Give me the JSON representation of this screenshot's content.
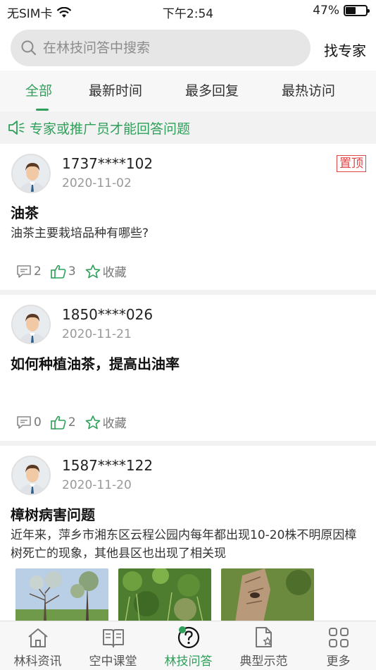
{
  "status_bar": {
    "carrier": "无SIM卡",
    "time": "下午2:54",
    "battery_percent": "47%",
    "battery_level": 0.47
  },
  "search": {
    "placeholder": "在林技问答中搜索",
    "expert_label": "找专家"
  },
  "tabs": [
    {
      "label": "全部",
      "active": true
    },
    {
      "label": "最新时间",
      "active": false
    },
    {
      "label": "最多回复",
      "active": false
    },
    {
      "label": "最热访问",
      "active": false
    }
  ],
  "notice": "专家或推广员才能回答问题",
  "questions": [
    {
      "user": "1737****102",
      "date": "2020-11-02",
      "pinned_label": "置顶",
      "title": "油茶",
      "body": "油茶主要栽培品种有哪些?",
      "comments": "2",
      "likes": "3",
      "favorite_label": "收藏"
    },
    {
      "user": "1850****026",
      "date": "2020-11-21",
      "title": "如何种植油茶，提高出油率",
      "body": "",
      "comments": "0",
      "likes": "2",
      "favorite_label": "收藏"
    },
    {
      "user": "1587****122",
      "date": "2020-11-20",
      "title": "樟树病害问题",
      "body": "近年来，萍乡市湘东区云程公园内每年都出现10-20株不明原因樟树死亡的现象，其他县区也出现了相关现"
    }
  ],
  "colors": {
    "accent": "#2fa05a",
    "pin": "#e04545"
  },
  "tabbar": [
    {
      "label": "林科资讯",
      "icon": "home-icon",
      "active": false
    },
    {
      "label": "空中课堂",
      "icon": "book-icon",
      "active": false
    },
    {
      "label": "林技问答",
      "icon": "question-icon",
      "active": true
    },
    {
      "label": "典型示范",
      "icon": "document-star-icon",
      "active": false
    },
    {
      "label": "更多",
      "icon": "grid-icon",
      "active": false
    }
  ]
}
